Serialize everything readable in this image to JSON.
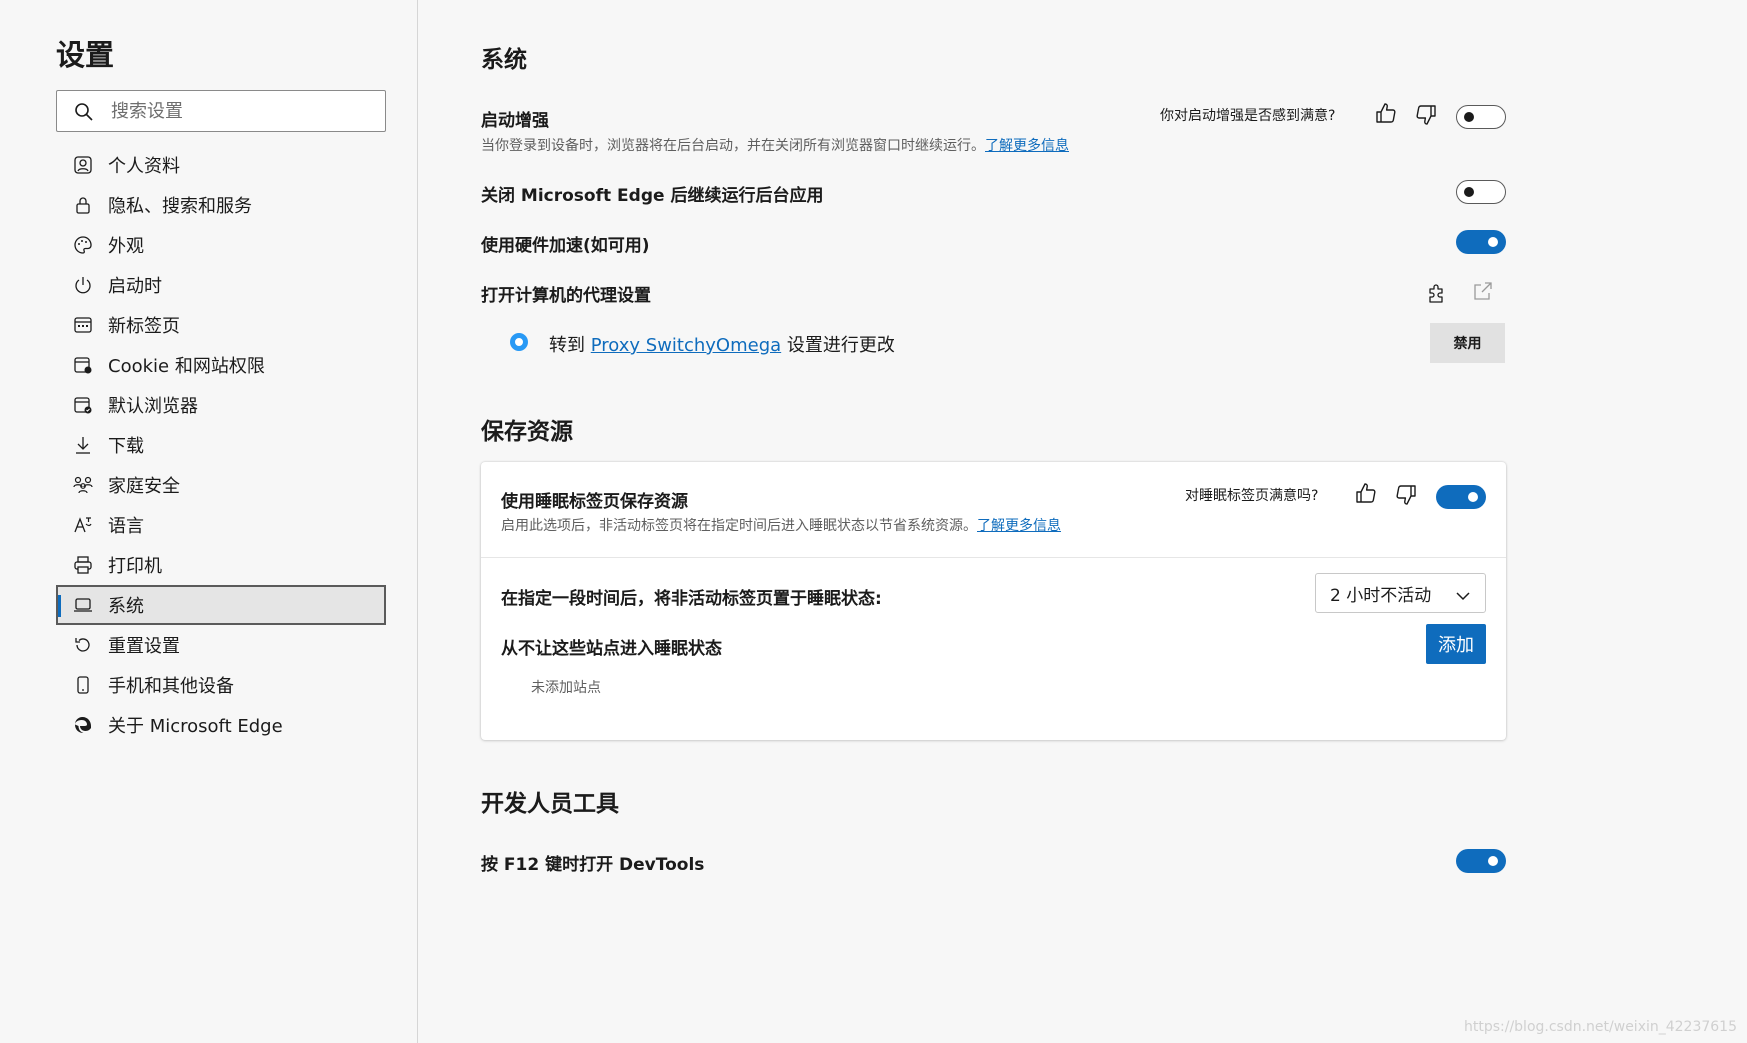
{
  "sidebar": {
    "title": "设置",
    "search_placeholder": "搜索设置",
    "items": [
      {
        "label": "个人资料",
        "icon": "profile-icon"
      },
      {
        "label": "隐私、搜索和服务",
        "icon": "lock-icon"
      },
      {
        "label": "外观",
        "icon": "palette-icon"
      },
      {
        "label": "启动时",
        "icon": "power-icon"
      },
      {
        "label": "新标签页",
        "icon": "new-tab-icon"
      },
      {
        "label": "Cookie 和网站权限",
        "icon": "site-permissions-icon"
      },
      {
        "label": "默认浏览器",
        "icon": "default-browser-icon"
      },
      {
        "label": "下载",
        "icon": "download-icon"
      },
      {
        "label": "家庭安全",
        "icon": "family-icon"
      },
      {
        "label": "语言",
        "icon": "language-icon"
      },
      {
        "label": "打印机",
        "icon": "printer-icon"
      },
      {
        "label": "系统",
        "icon": "system-icon",
        "active": true
      },
      {
        "label": "重置设置",
        "icon": "reset-icon"
      },
      {
        "label": "手机和其他设备",
        "icon": "phone-icon"
      },
      {
        "label": "关于 Microsoft Edge",
        "icon": "edge-icon"
      }
    ]
  },
  "system": {
    "title": "系统",
    "startup_boost": {
      "title": "启动增强",
      "desc": "当你登录到设备时，浏览器将在后台启动，并在关闭所有浏览器窗口时继续运行。",
      "link": "了解更多信息",
      "feedback": "你对启动增强是否感到满意?",
      "enabled": false
    },
    "background_apps": {
      "title": "关闭 Microsoft Edge 后继续运行后台应用",
      "enabled": false
    },
    "hardware_accel": {
      "title": "使用硬件加速(如可用)",
      "enabled": true
    },
    "proxy": {
      "title": "打开计算机的代理设置",
      "prefix": "转到",
      "extension": "Proxy SwitchyOmega",
      "suffix": "设置进行更改",
      "disable_button": "禁用"
    }
  },
  "resources": {
    "title": "保存资源",
    "sleeping_tabs": {
      "title": "使用睡眠标签页保存资源",
      "desc": "启用此选项后，非活动标签页将在指定时间后进入睡眠状态以节省系统资源。",
      "link": "了解更多信息",
      "feedback": "对睡眠标签页满意吗?",
      "enabled": true
    },
    "timeout": {
      "label": "在指定一段时间后，将非活动标签页置于睡眠状态:",
      "value": "2 小时不活动"
    },
    "never_sleep": {
      "label": "从不让这些站点进入睡眠状态",
      "add_button": "添加",
      "empty": "未添加站点"
    }
  },
  "devtools": {
    "title": "开发人员工具",
    "f12": {
      "title": "按 F12 键时打开 DevTools",
      "enabled": true
    }
  },
  "watermark": "https://blog.csdn.net/weixin_42237615",
  "colors": {
    "accent": "#0f6cbd",
    "radio": "#2899f5"
  }
}
